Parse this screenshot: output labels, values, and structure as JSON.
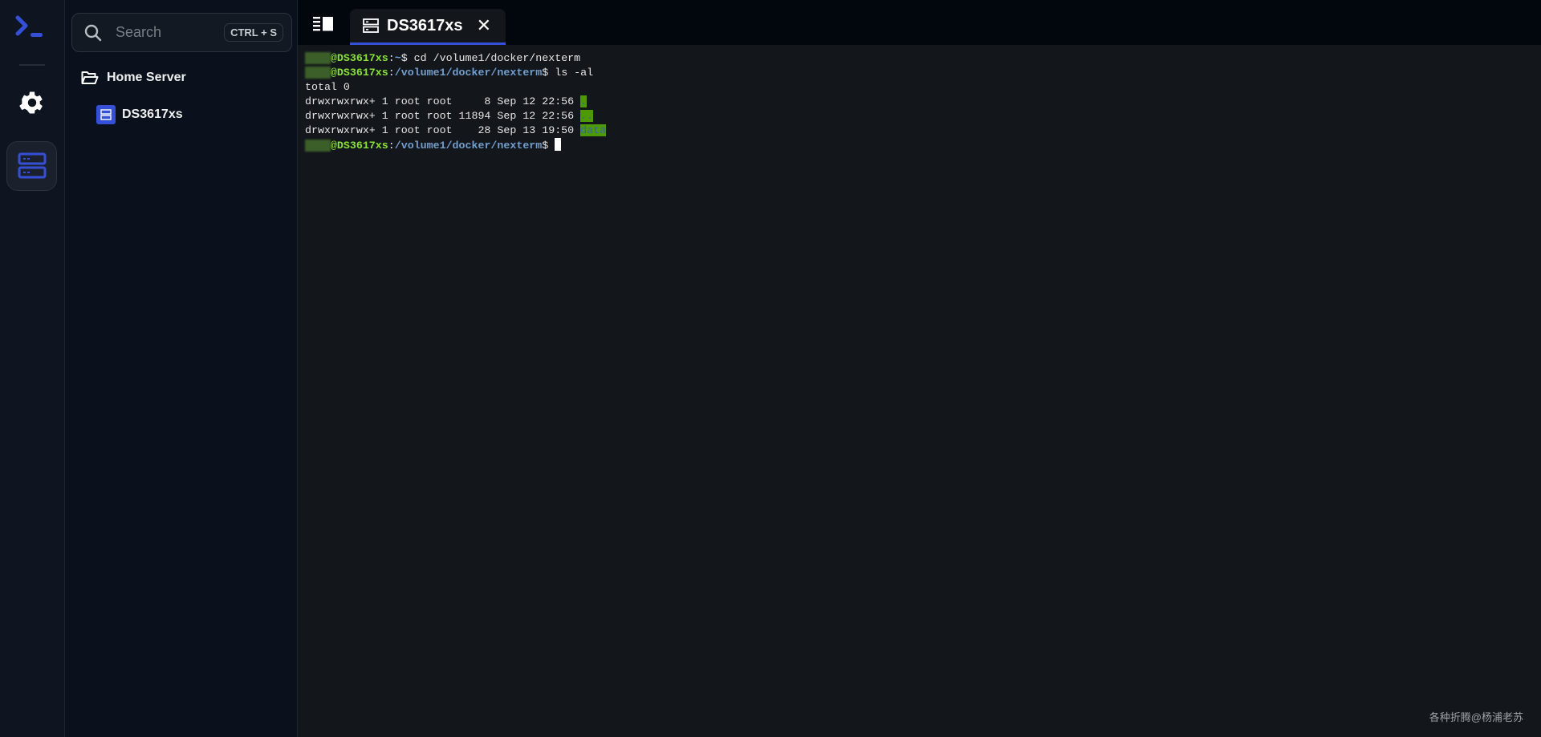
{
  "app": {
    "accent": "#3550d6"
  },
  "rail": {
    "items": [
      {
        "icon": "terminal-logo-icon"
      },
      {
        "icon": "gear-icon"
      },
      {
        "icon": "server-icon",
        "active": true
      }
    ]
  },
  "sidebar": {
    "search": {
      "placeholder": "Search",
      "shortcut": "CTRL + S"
    },
    "folder": {
      "label": "Home Server",
      "icon": "folder-open-icon"
    },
    "servers": [
      {
        "label": "DS3617xs",
        "icon": "server-icon"
      }
    ]
  },
  "tabs": [
    {
      "label": "DS3617xs",
      "icon": "server-icon",
      "active": true,
      "close": "✕"
    }
  ],
  "terminal": {
    "host": "@DS3617xs",
    "lines": [
      {
        "path": "~",
        "cmd": "$ cd /volume1/docker/nexterm"
      },
      {
        "path": "/volume1/docker/nexterm",
        "cmd": "$ ls -al"
      },
      {
        "text": "total 0"
      },
      {
        "text": "drwxrwxrwx+ 1 root root     8 Sep 12 22:56 ",
        "name": "."
      },
      {
        "text": "drwxrwxrwx+ 1 root root 11894 Sep 12 22:56 ",
        "name": ".."
      },
      {
        "text": "drwxrwxrwx+ 1 root root    28 Sep 13 19:50 ",
        "name": "data"
      },
      {
        "path": "/volume1/docker/nexterm",
        "cmd": "$ "
      }
    ]
  },
  "watermark": "各种折腾@杨浦老苏"
}
